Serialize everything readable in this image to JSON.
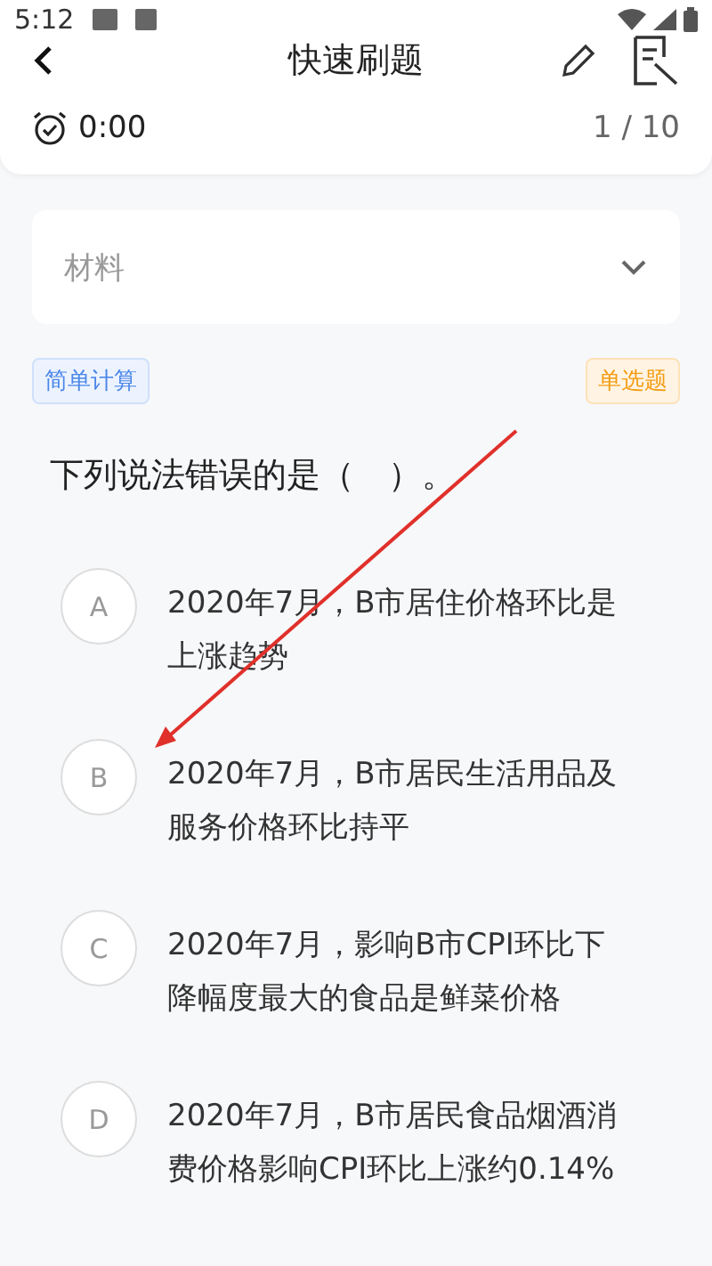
{
  "status_bar": {
    "time": "5:12"
  },
  "header": {
    "title": "快速刷题"
  },
  "progress": {
    "timer": "0:00",
    "count": "1 / 10"
  },
  "material": {
    "label": "材料",
    "expanded": false
  },
  "tags": [
    {
      "label": "简单计算",
      "kind": "category"
    },
    {
      "label": "单选题",
      "kind": "type"
    }
  ],
  "question": "下列说法错误的是（　）。",
  "options": [
    {
      "letter": "A",
      "text": "2020年7月，B市居住价格环比是上涨趋势",
      "selected": false
    },
    {
      "letter": "B",
      "text": "2020年7月，B市居民生活用品及服务价格环比持平",
      "selected": false
    },
    {
      "letter": "C",
      "text": "2020年7月，影响B市CPI环比下降幅度最大的食品是鲜菜价格",
      "selected": false
    },
    {
      "letter": "D",
      "text": "2020年7月，B市居民食品烟酒消费价格影响CPI环比上涨约0.14%",
      "selected": false
    }
  ]
}
